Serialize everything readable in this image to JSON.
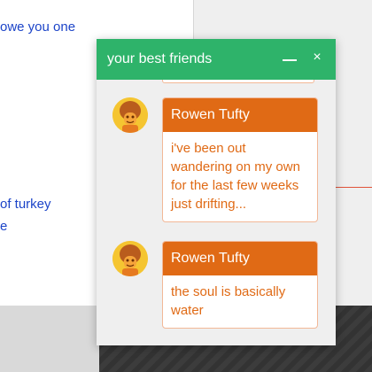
{
  "background": {
    "doc_lines": [
      "owe you one",
      "of turkey",
      "e"
    ]
  },
  "chat": {
    "title": "your best friends",
    "minimize_icon": "minimize-icon",
    "close_icon": "close-icon",
    "close_glyph": "×",
    "messages": [
      {
        "sender": "Rowen Tufty",
        "text": "i've been out wandering on my own for the last few weeks just drifting...",
        "avatar": "avatar"
      },
      {
        "sender": "Rowen Tufty",
        "text": "the soul is basically water",
        "avatar": "avatar"
      }
    ]
  },
  "colors": {
    "header": "#2eb36a",
    "bubble_header": "#e06a15",
    "bubble_text": "#e06a15",
    "link_text": "#1c44c8",
    "avatar_bg": "#f5c531"
  }
}
